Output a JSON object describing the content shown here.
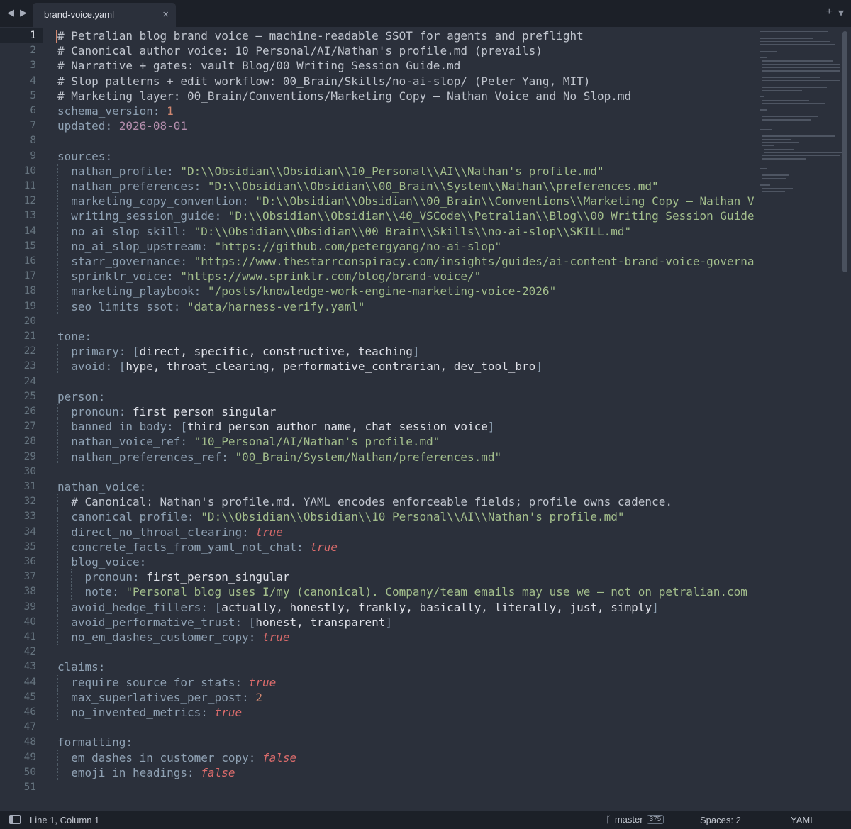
{
  "tab": {
    "title": "brand-voice.yaml",
    "close": "×"
  },
  "nav": {
    "back": "◀",
    "forward": "▶"
  },
  "tools": {
    "add": "+",
    "menu": "▾"
  },
  "lines": [
    [
      [
        "c-comment",
        "# Petralian blog brand voice — machine-readable SSOT for agents and preflight"
      ]
    ],
    [
      [
        "c-comment",
        "# Canonical author voice: 10_Personal/AI/Nathan's profile.md (prevails)"
      ]
    ],
    [
      [
        "c-comment",
        "# Narrative + gates: vault Blog/00 Writing Session Guide.md"
      ]
    ],
    [
      [
        "c-comment",
        "# Slop patterns + edit workflow: 00_Brain/Skills/no-ai-slop/ (Peter Yang, MIT)"
      ]
    ],
    [
      [
        "c-comment",
        "# Marketing layer: 00_Brain/Conventions/Marketing Copy — Nathan Voice and No Slop.md"
      ]
    ],
    [
      [
        "c-key",
        "schema_version"
      ],
      [
        "c-punct",
        ": "
      ],
      [
        "c-num",
        "1"
      ]
    ],
    [
      [
        "c-key",
        "updated"
      ],
      [
        "c-punct",
        ": "
      ],
      [
        "c-date",
        "2026-08-01"
      ]
    ],
    [],
    [
      [
        "c-key",
        "sources"
      ],
      [
        "c-punct",
        ":"
      ]
    ],
    [
      [
        "c-word",
        "  "
      ],
      [
        "c-key",
        "nathan_profile"
      ],
      [
        "c-punct",
        ": "
      ],
      [
        "c-str",
        "\"D:\\\\Obsidian\\\\Obsidian\\\\10_Personal\\\\AI\\\\Nathan's profile.md\""
      ]
    ],
    [
      [
        "c-word",
        "  "
      ],
      [
        "c-key",
        "nathan_preferences"
      ],
      [
        "c-punct",
        ": "
      ],
      [
        "c-str",
        "\"D:\\\\Obsidian\\\\Obsidian\\\\00_Brain\\\\System\\\\Nathan\\\\preferences.md\""
      ]
    ],
    [
      [
        "c-word",
        "  "
      ],
      [
        "c-key",
        "marketing_copy_convention"
      ],
      [
        "c-punct",
        ": "
      ],
      [
        "c-str",
        "\"D:\\\\Obsidian\\\\Obsidian\\\\00_Brain\\\\Conventions\\\\Marketing Copy — Nathan V"
      ]
    ],
    [
      [
        "c-word",
        "  "
      ],
      [
        "c-key",
        "writing_session_guide"
      ],
      [
        "c-punct",
        ": "
      ],
      [
        "c-str",
        "\"D:\\\\Obsidian\\\\Obsidian\\\\40_VSCode\\\\Petralian\\\\Blog\\\\00 Writing Session Guide"
      ]
    ],
    [
      [
        "c-word",
        "  "
      ],
      [
        "c-key",
        "no_ai_slop_skill"
      ],
      [
        "c-punct",
        ": "
      ],
      [
        "c-str",
        "\"D:\\\\Obsidian\\\\Obsidian\\\\00_Brain\\\\Skills\\\\no-ai-slop\\\\SKILL.md\""
      ]
    ],
    [
      [
        "c-word",
        "  "
      ],
      [
        "c-key",
        "no_ai_slop_upstream"
      ],
      [
        "c-punct",
        ": "
      ],
      [
        "c-str",
        "\"https://github.com/petergyang/no-ai-slop\""
      ]
    ],
    [
      [
        "c-word",
        "  "
      ],
      [
        "c-key",
        "starr_governance"
      ],
      [
        "c-punct",
        ": "
      ],
      [
        "c-str",
        "\"https://www.thestarrconspiracy.com/insights/guides/ai-content-brand-voice-governa"
      ]
    ],
    [
      [
        "c-word",
        "  "
      ],
      [
        "c-key",
        "sprinklr_voice"
      ],
      [
        "c-punct",
        ": "
      ],
      [
        "c-str",
        "\"https://www.sprinklr.com/blog/brand-voice/\""
      ]
    ],
    [
      [
        "c-word",
        "  "
      ],
      [
        "c-key",
        "marketing_playbook"
      ],
      [
        "c-punct",
        ": "
      ],
      [
        "c-str",
        "\"/posts/knowledge-work-engine-marketing-voice-2026\""
      ]
    ],
    [
      [
        "c-word",
        "  "
      ],
      [
        "c-key",
        "seo_limits_ssot"
      ],
      [
        "c-punct",
        ": "
      ],
      [
        "c-str",
        "\"data/harness-verify.yaml\""
      ]
    ],
    [],
    [
      [
        "c-key",
        "tone"
      ],
      [
        "c-punct",
        ":"
      ]
    ],
    [
      [
        "c-word",
        "  "
      ],
      [
        "c-key",
        "primary"
      ],
      [
        "c-punct",
        ": "
      ],
      [
        "c-bracket",
        "["
      ],
      [
        "c-word",
        "direct, specific, constructive, teaching"
      ],
      [
        "c-bracket",
        "]"
      ]
    ],
    [
      [
        "c-word",
        "  "
      ],
      [
        "c-key",
        "avoid"
      ],
      [
        "c-punct",
        ": "
      ],
      [
        "c-bracket",
        "["
      ],
      [
        "c-word",
        "hype, throat_clearing, performative_contrarian, dev_tool_bro"
      ],
      [
        "c-bracket",
        "]"
      ]
    ],
    [],
    [
      [
        "c-key",
        "person"
      ],
      [
        "c-punct",
        ":"
      ]
    ],
    [
      [
        "c-word",
        "  "
      ],
      [
        "c-key",
        "pronoun"
      ],
      [
        "c-punct",
        ": "
      ],
      [
        "c-word",
        "first_person_singular"
      ]
    ],
    [
      [
        "c-word",
        "  "
      ],
      [
        "c-key",
        "banned_in_body"
      ],
      [
        "c-punct",
        ": "
      ],
      [
        "c-bracket",
        "["
      ],
      [
        "c-word",
        "third_person_author_name, chat_session_voice"
      ],
      [
        "c-bracket",
        "]"
      ]
    ],
    [
      [
        "c-word",
        "  "
      ],
      [
        "c-key",
        "nathan_voice_ref"
      ],
      [
        "c-punct",
        ": "
      ],
      [
        "c-str",
        "\"10_Personal/AI/Nathan's profile.md\""
      ]
    ],
    [
      [
        "c-word",
        "  "
      ],
      [
        "c-key",
        "nathan_preferences_ref"
      ],
      [
        "c-punct",
        ": "
      ],
      [
        "c-str",
        "\"00_Brain/System/Nathan/preferences.md\""
      ]
    ],
    [],
    [
      [
        "c-key",
        "nathan_voice"
      ],
      [
        "c-punct",
        ":"
      ]
    ],
    [
      [
        "c-word",
        "  "
      ],
      [
        "c-comment",
        "# Canonical: Nathan's profile.md. YAML encodes enforceable fields; profile owns cadence."
      ]
    ],
    [
      [
        "c-word",
        "  "
      ],
      [
        "c-key",
        "canonical_profile"
      ],
      [
        "c-punct",
        ": "
      ],
      [
        "c-str",
        "\"D:\\\\Obsidian\\\\Obsidian\\\\10_Personal\\\\AI\\\\Nathan's profile.md\""
      ]
    ],
    [
      [
        "c-word",
        "  "
      ],
      [
        "c-key",
        "direct_no_throat_clearing"
      ],
      [
        "c-punct",
        ": "
      ],
      [
        "c-bool",
        "true"
      ]
    ],
    [
      [
        "c-word",
        "  "
      ],
      [
        "c-key",
        "concrete_facts_from_yaml_not_chat"
      ],
      [
        "c-punct",
        ": "
      ],
      [
        "c-bool",
        "true"
      ]
    ],
    [
      [
        "c-word",
        "  "
      ],
      [
        "c-key",
        "blog_voice"
      ],
      [
        "c-punct",
        ":"
      ]
    ],
    [
      [
        "c-word",
        "    "
      ],
      [
        "c-key",
        "pronoun"
      ],
      [
        "c-punct",
        ": "
      ],
      [
        "c-word",
        "first_person_singular"
      ]
    ],
    [
      [
        "c-word",
        "    "
      ],
      [
        "c-key",
        "note"
      ],
      [
        "c-punct",
        ": "
      ],
      [
        "c-str",
        "\"Personal blog uses I/my (canonical). Company/team emails may use we — not on petralian.com"
      ]
    ],
    [
      [
        "c-word",
        "  "
      ],
      [
        "c-key",
        "avoid_hedge_fillers"
      ],
      [
        "c-punct",
        ": "
      ],
      [
        "c-bracket",
        "["
      ],
      [
        "c-word",
        "actually, honestly, frankly, basically, literally, just, simply"
      ],
      [
        "c-bracket",
        "]"
      ]
    ],
    [
      [
        "c-word",
        "  "
      ],
      [
        "c-key",
        "avoid_performative_trust"
      ],
      [
        "c-punct",
        ": "
      ],
      [
        "c-bracket",
        "["
      ],
      [
        "c-word",
        "honest, transparent"
      ],
      [
        "c-bracket",
        "]"
      ]
    ],
    [
      [
        "c-word",
        "  "
      ],
      [
        "c-key",
        "no_em_dashes_customer_copy"
      ],
      [
        "c-punct",
        ": "
      ],
      [
        "c-bool",
        "true"
      ]
    ],
    [],
    [
      [
        "c-key",
        "claims"
      ],
      [
        "c-punct",
        ":"
      ]
    ],
    [
      [
        "c-word",
        "  "
      ],
      [
        "c-key",
        "require_source_for_stats"
      ],
      [
        "c-punct",
        ": "
      ],
      [
        "c-bool",
        "true"
      ]
    ],
    [
      [
        "c-word",
        "  "
      ],
      [
        "c-key",
        "max_superlatives_per_post"
      ],
      [
        "c-punct",
        ": "
      ],
      [
        "c-num",
        "2"
      ]
    ],
    [
      [
        "c-word",
        "  "
      ],
      [
        "c-key",
        "no_invented_metrics"
      ],
      [
        "c-punct",
        ": "
      ],
      [
        "c-bool",
        "true"
      ]
    ],
    [],
    [
      [
        "c-key",
        "formatting"
      ],
      [
        "c-punct",
        ":"
      ]
    ],
    [
      [
        "c-word",
        "  "
      ],
      [
        "c-key",
        "em_dashes_in_customer_copy"
      ],
      [
        "c-punct",
        ": "
      ],
      [
        "c-bool",
        "false"
      ]
    ],
    [
      [
        "c-word",
        "  "
      ],
      [
        "c-key",
        "emoji_in_headings"
      ],
      [
        "c-punct",
        ": "
      ],
      [
        "c-bool",
        "false"
      ]
    ],
    []
  ],
  "status": {
    "position": "Line 1, Column 1",
    "branch": "master",
    "branch_count": "375",
    "spaces": "Spaces: 2",
    "syntax": "YAML"
  },
  "colors": {
    "background": "#2b303b",
    "key": "#8fa1b3",
    "string": "#a3be8c",
    "number": "#d08770",
    "boolean": "#d96b6b",
    "date": "#b48ead"
  }
}
